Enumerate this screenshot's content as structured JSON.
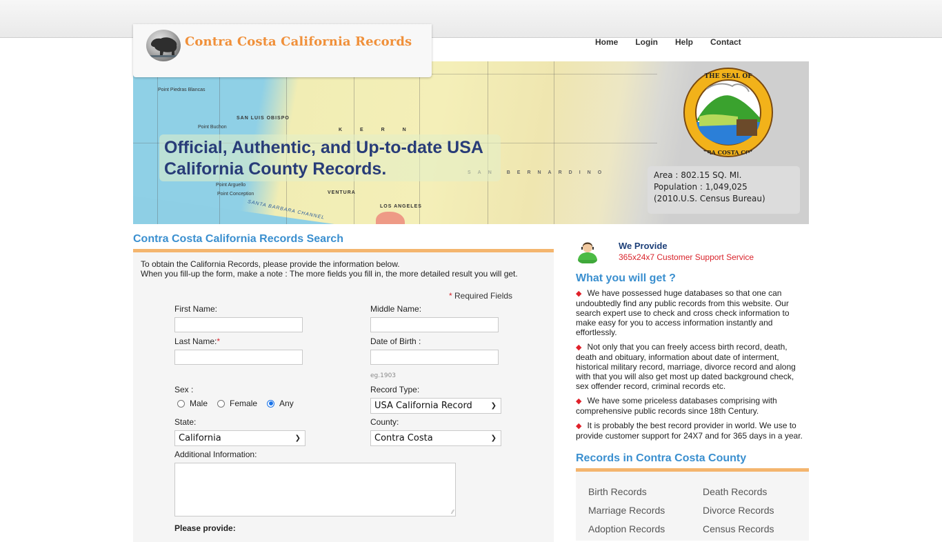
{
  "site": {
    "title": "Contra Costa California Records",
    "logo_icon": "california-bear-icon"
  },
  "nav": {
    "items": [
      {
        "label": "Home"
      },
      {
        "label": "Login"
      },
      {
        "label": "Help"
      },
      {
        "label": "Contact"
      }
    ]
  },
  "banner": {
    "headline_line1": "Official, Authentic, and Up-to-date USA",
    "headline_line2": "California County Records.",
    "seal_icon": "county-seal-icon",
    "map_labels": [
      "SAN LUIS OBISPO",
      "K E R N",
      "VENTURA",
      "LOS ANGELES",
      "SAN BERNARDINO",
      "Point Piedras Blancas",
      "Point Buchon",
      "Point Arguello",
      "Point Conception",
      "SANTA BARBARA CHANNEL"
    ],
    "stats": {
      "area": "Area : 802.15 SQ. MI.",
      "population": "Population : 1,049,025",
      "source": "(2010.U.S. Census Bureau)"
    }
  },
  "search": {
    "title": "Contra Costa California Records Search",
    "intro_line1": "To obtain the California Records, please provide the information below.",
    "intro_line2": "When you fill-up the form, make a note : The more fields you fill in, the more detailed result you will get.",
    "required_note": "Required Fields",
    "required_star": "*",
    "fields": {
      "first_name": {
        "label": "First Name:",
        "value": ""
      },
      "middle_name": {
        "label": "Middle Name:",
        "value": ""
      },
      "last_name": {
        "label": "Last Name:",
        "value": ""
      },
      "dob": {
        "label": "Date of Birth :",
        "value": "",
        "hint": "eg.1903"
      },
      "sex": {
        "label": "Sex :",
        "options": [
          "Male",
          "Female",
          "Any"
        ],
        "selected": "Any"
      },
      "record_type": {
        "label": "Record Type:",
        "value": "USA California Record"
      },
      "state": {
        "label": "State:",
        "value": "California"
      },
      "county": {
        "label": "County:",
        "value": "Contra Costa"
      },
      "additional": {
        "label": "Additional Information:",
        "value": ""
      }
    },
    "please_provide": "Please provide:"
  },
  "sidebar": {
    "support_title": "We Provide",
    "support_sub": "365x24x7 Customer Support Service",
    "get_title": "What you will get ?",
    "bullets": [
      "We have possessed huge databases so that one can undoubtedly find any public records from this website. Our search expert use to check and cross check information to make easy for you to access information instantly and effortlessly.",
      "Not only that you can freely access birth record, death, death and obituary, information about date of interment, historical military record, marriage, divorce record and along with that you will also get most up dated background check, sex offender record, criminal records etc.",
      "We have some priceless databases comprising with comprehensive public records since 18th Century.",
      "It is probably the best record provider in world. We use to provide customer support for 24X7 and for 365 days in a year."
    ],
    "records_title": "Records in Contra Costa County",
    "records": [
      "Birth Records",
      "Death Records",
      "Marriage Records",
      "Divorce Records",
      "Adoption Records",
      "Census Records"
    ]
  },
  "colors": {
    "accent_orange": "#f0903a",
    "panel_border": "#f4b56e",
    "heading_blue": "#3a8fcf",
    "headline_navy": "#283c78",
    "required_red": "#d9232b"
  }
}
